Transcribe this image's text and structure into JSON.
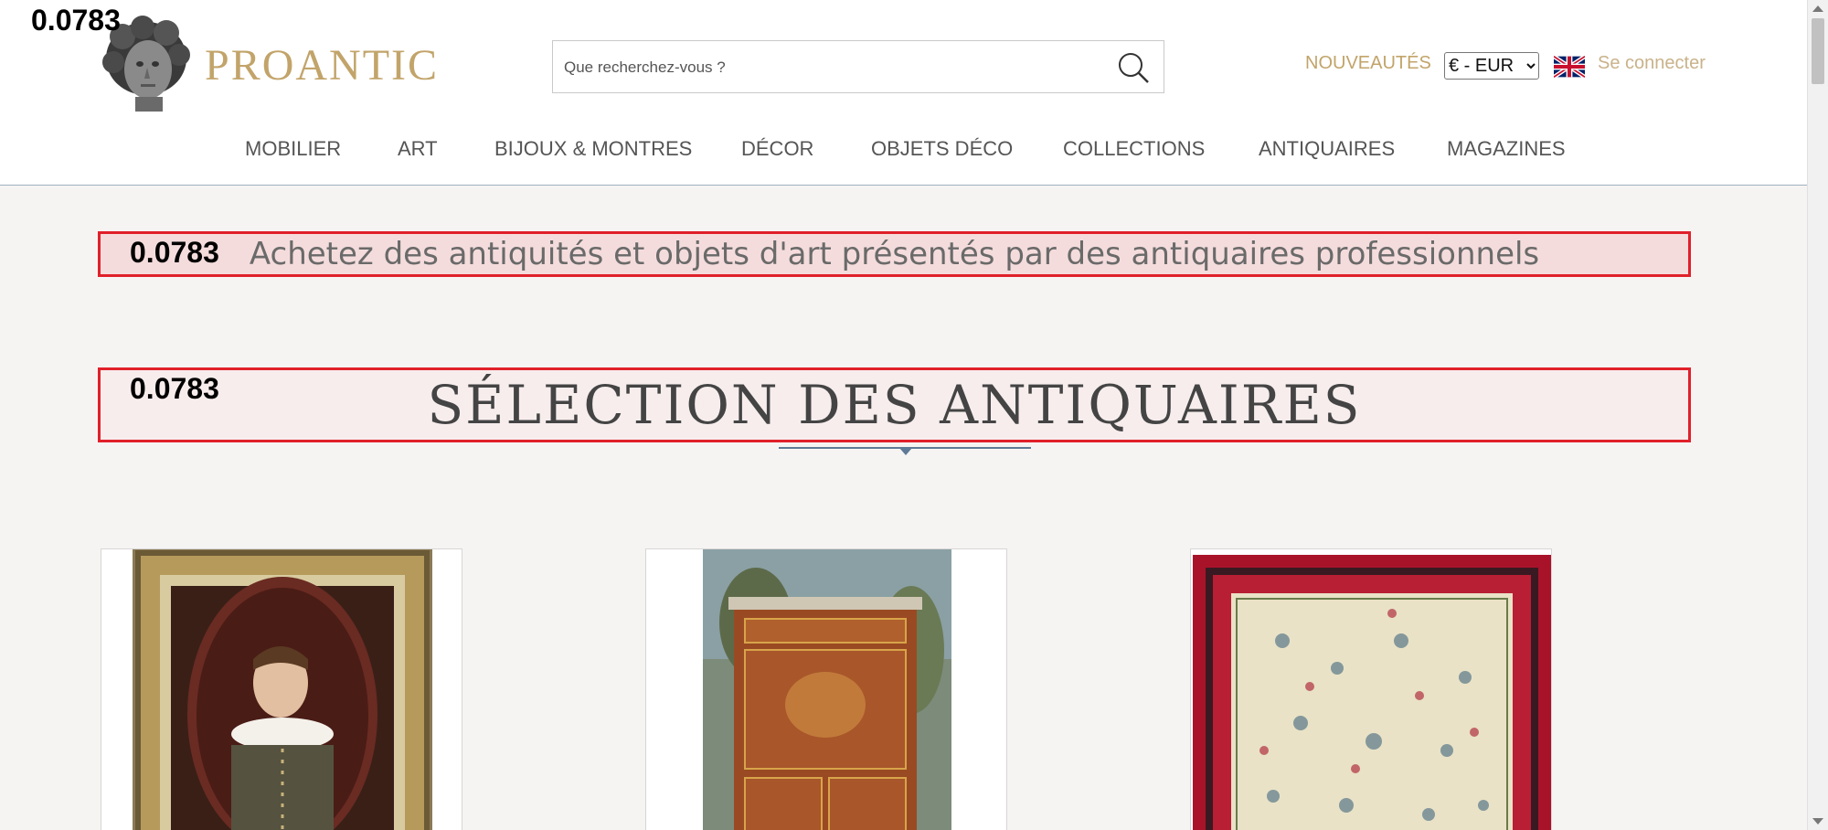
{
  "debug_value": "0.0783",
  "brand": {
    "name": "PROANTIC",
    "logo_icon": "bust-icon",
    "color": "#c2a46a"
  },
  "search": {
    "placeholder": "Que recherchez-vous ?",
    "value": "",
    "icon": "search-icon"
  },
  "header_right": {
    "new_label": "NOUVEAUTÉS",
    "currency_selected": "€ - EUR",
    "language_icon": "uk-flag-icon",
    "login_label": "Se connecter"
  },
  "nav": {
    "items": [
      "MOBILIER",
      "ART",
      "BIJOUX & MONTRES",
      "DÉCOR",
      "OBJETS DÉCO",
      "COLLECTIONS",
      "ANTIQUAIRES",
      "MAGAZINES"
    ]
  },
  "tagline": "Achetez des antiquités et objets d'art présentés par des antiquaires professionnels",
  "section": {
    "title": "SÉLECTION DES ANTIQUAIRES"
  },
  "colors": {
    "highlight_border": "#e0202a",
    "accent_gold": "#c2a46a",
    "underline": "#5d7a96"
  }
}
